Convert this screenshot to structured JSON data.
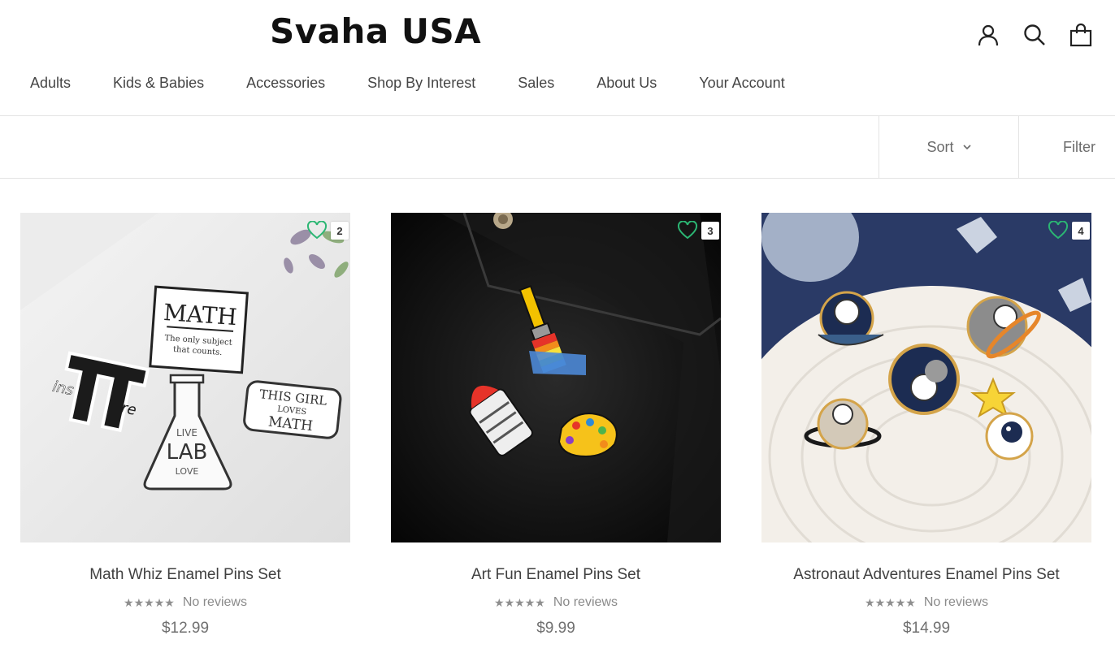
{
  "header": {
    "logo": "Svaha USA",
    "nav": [
      "Adults",
      "Kids & Babies",
      "Accessories",
      "Shop By Interest",
      "Sales",
      "About Us",
      "Your Account"
    ]
  },
  "toolbar": {
    "sort_label": "Sort",
    "filter_label": "Filter"
  },
  "products": [
    {
      "title": "Math Whiz Enamel Pins Set",
      "reviews": "No reviews",
      "stars": "★★★★★",
      "price": "$12.99",
      "wishlist_count": "2"
    },
    {
      "title": "Art Fun Enamel Pins Set",
      "reviews": "No reviews",
      "stars": "★★★★★",
      "price": "$9.99",
      "wishlist_count": "3"
    },
    {
      "title": "Astronaut Adventures Enamel Pins Set",
      "reviews": "No reviews",
      "stars": "★★★★★",
      "price": "$14.99",
      "wishlist_count": "4"
    }
  ],
  "product_image_text": {
    "math_card": "MATH",
    "math_card_sub1": "The only subject",
    "math_card_sub2": "that counts.",
    "pi_left": "ins",
    "pi_right": "re",
    "lab_top": "LIVE",
    "lab_mid": "LAB",
    "lab_bottom": "LOVE",
    "girl_line1": "THIS GIRL",
    "girl_line2": "LOVES",
    "girl_line3": "MATH"
  },
  "colors": {
    "wishlist_green": "#2bb673",
    "text_dark": "#404040",
    "border": "#e3e3e3"
  },
  "icons": [
    "account-icon",
    "search-icon",
    "cart-bag-icon",
    "chevron-down-icon",
    "heart-icon"
  ]
}
